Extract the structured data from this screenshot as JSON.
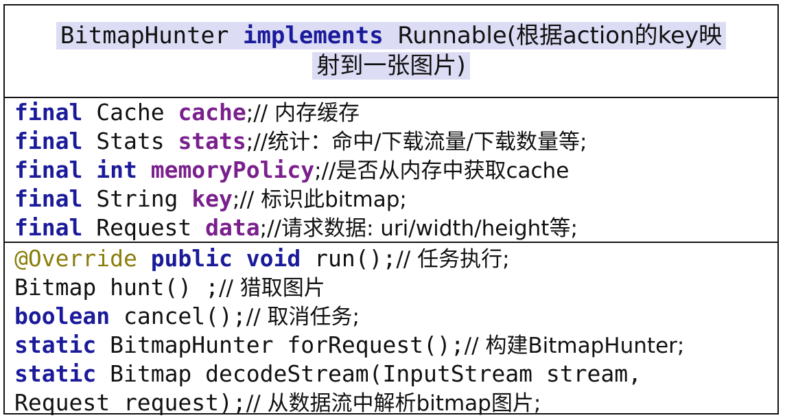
{
  "title": {
    "class_name": "BitmapHunter",
    "keyword": "implements",
    "interface": "Runnable(根据action的key映",
    "interface_cont": "射到一张图片)"
  },
  "fields": [
    {
      "mod": "final",
      "type": "Cache",
      "name": "cache",
      "comment": ";// 内存缓存"
    },
    {
      "mod": "final",
      "type": "Stats",
      "name": "stats",
      "comment": ";//统计：命中/下载流量/下载数量等;"
    },
    {
      "mod": "final",
      "type": "int",
      "name": "memoryPolicy",
      "comment": ";//是否从内存中获取cache"
    },
    {
      "mod": "final",
      "type": "String",
      "name": "key",
      "comment": ";// 标识此bitmap;"
    },
    {
      "mod": "final",
      "type": "Request",
      "name": "data",
      "comment": ";//请求数据: uri/width/height等;"
    }
  ],
  "methods": {
    "run": {
      "annotation": "@Override",
      "kw1": "public",
      "kw2": "void",
      "sig": "run();",
      "comment": "// 任务执行;"
    },
    "hunt": {
      "sig": "Bitmap hunt() ;",
      "comment": "// 猎取图片"
    },
    "cancel": {
      "kw": "boolean",
      "sig": "cancel();",
      "comment": "// 取消任务;"
    },
    "forRequest": {
      "kw": "static",
      "sig": "BitmapHunter forRequest();",
      "comment": "// 构建BitmapHunter;"
    },
    "decodeStream": {
      "kw": "static",
      "sig": "Bitmap decodeStream(InputStream stream,",
      "sig_cont": "Request request);",
      "comment": "// 从数据流中解析bitmap图片;"
    }
  }
}
